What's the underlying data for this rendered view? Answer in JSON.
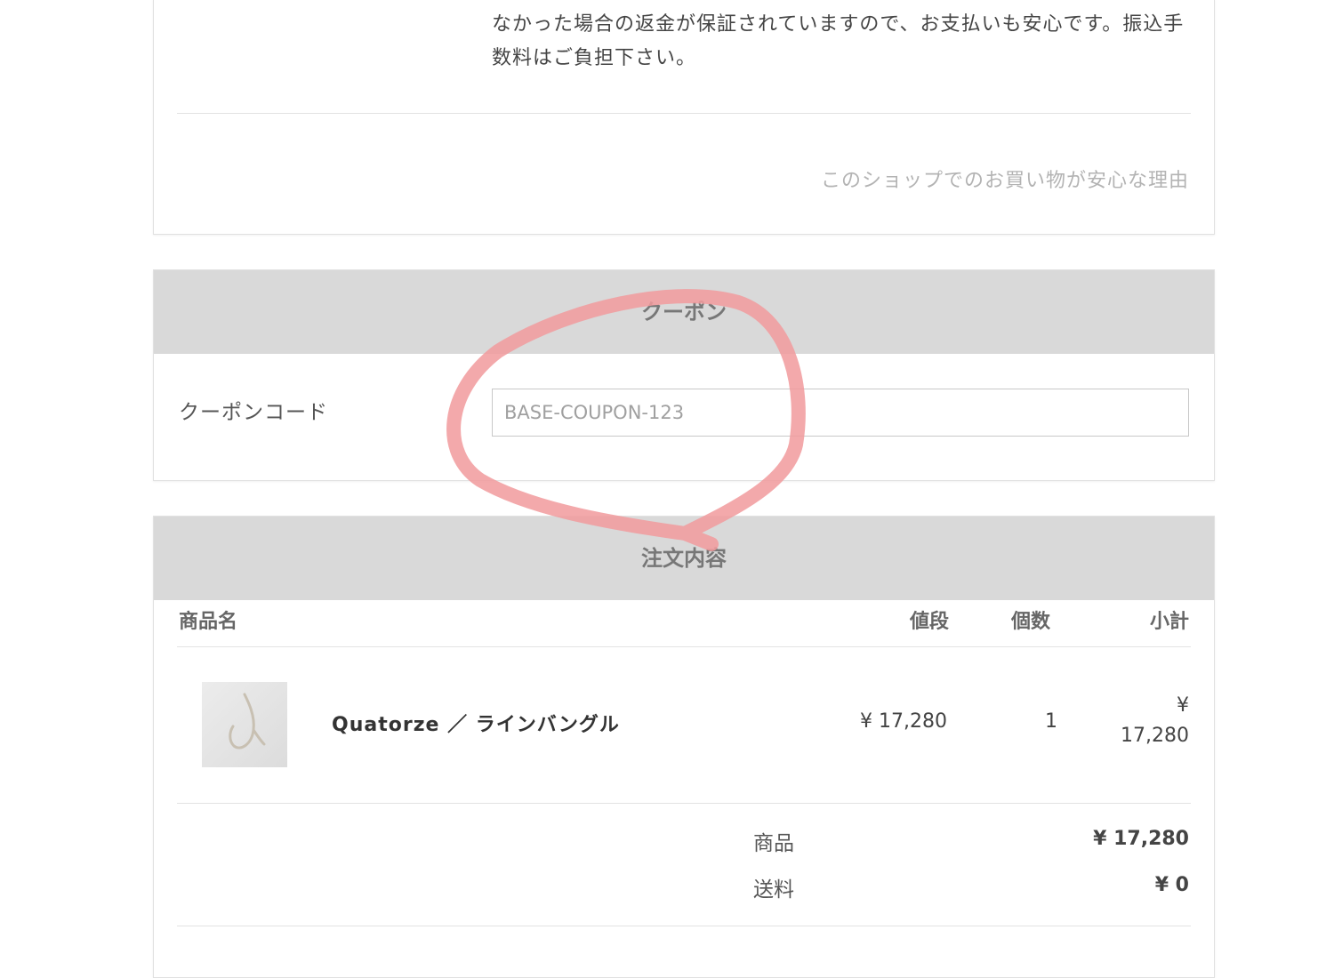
{
  "payment_info": {
    "description": "なかった場合の返金が保証されていますので、お支払いも安心です。振込手数料はご負担下さい。",
    "reason_link": "このショップでのお買い物が安心な理由"
  },
  "coupon": {
    "title": "クーポン",
    "code_label": "クーポンコード",
    "input_placeholder": "BASE-COUPON-123"
  },
  "order": {
    "title": "注文内容",
    "columns": {
      "name": "商品名",
      "price": "値段",
      "qty": "個数",
      "subtotal": "小計"
    },
    "items": [
      {
        "name": "Quatorze ／ ラインバングル",
        "price": "¥ 17,280",
        "qty": "1",
        "subtotal_symbol": "¥",
        "subtotal_value": "17,280"
      }
    ],
    "summary": {
      "goods_label": "商品",
      "goods_value": "¥ 17,280",
      "shipping_label": "送料",
      "shipping_value": "¥ 0"
    }
  },
  "annotation": {
    "color": "#f19a9c"
  }
}
